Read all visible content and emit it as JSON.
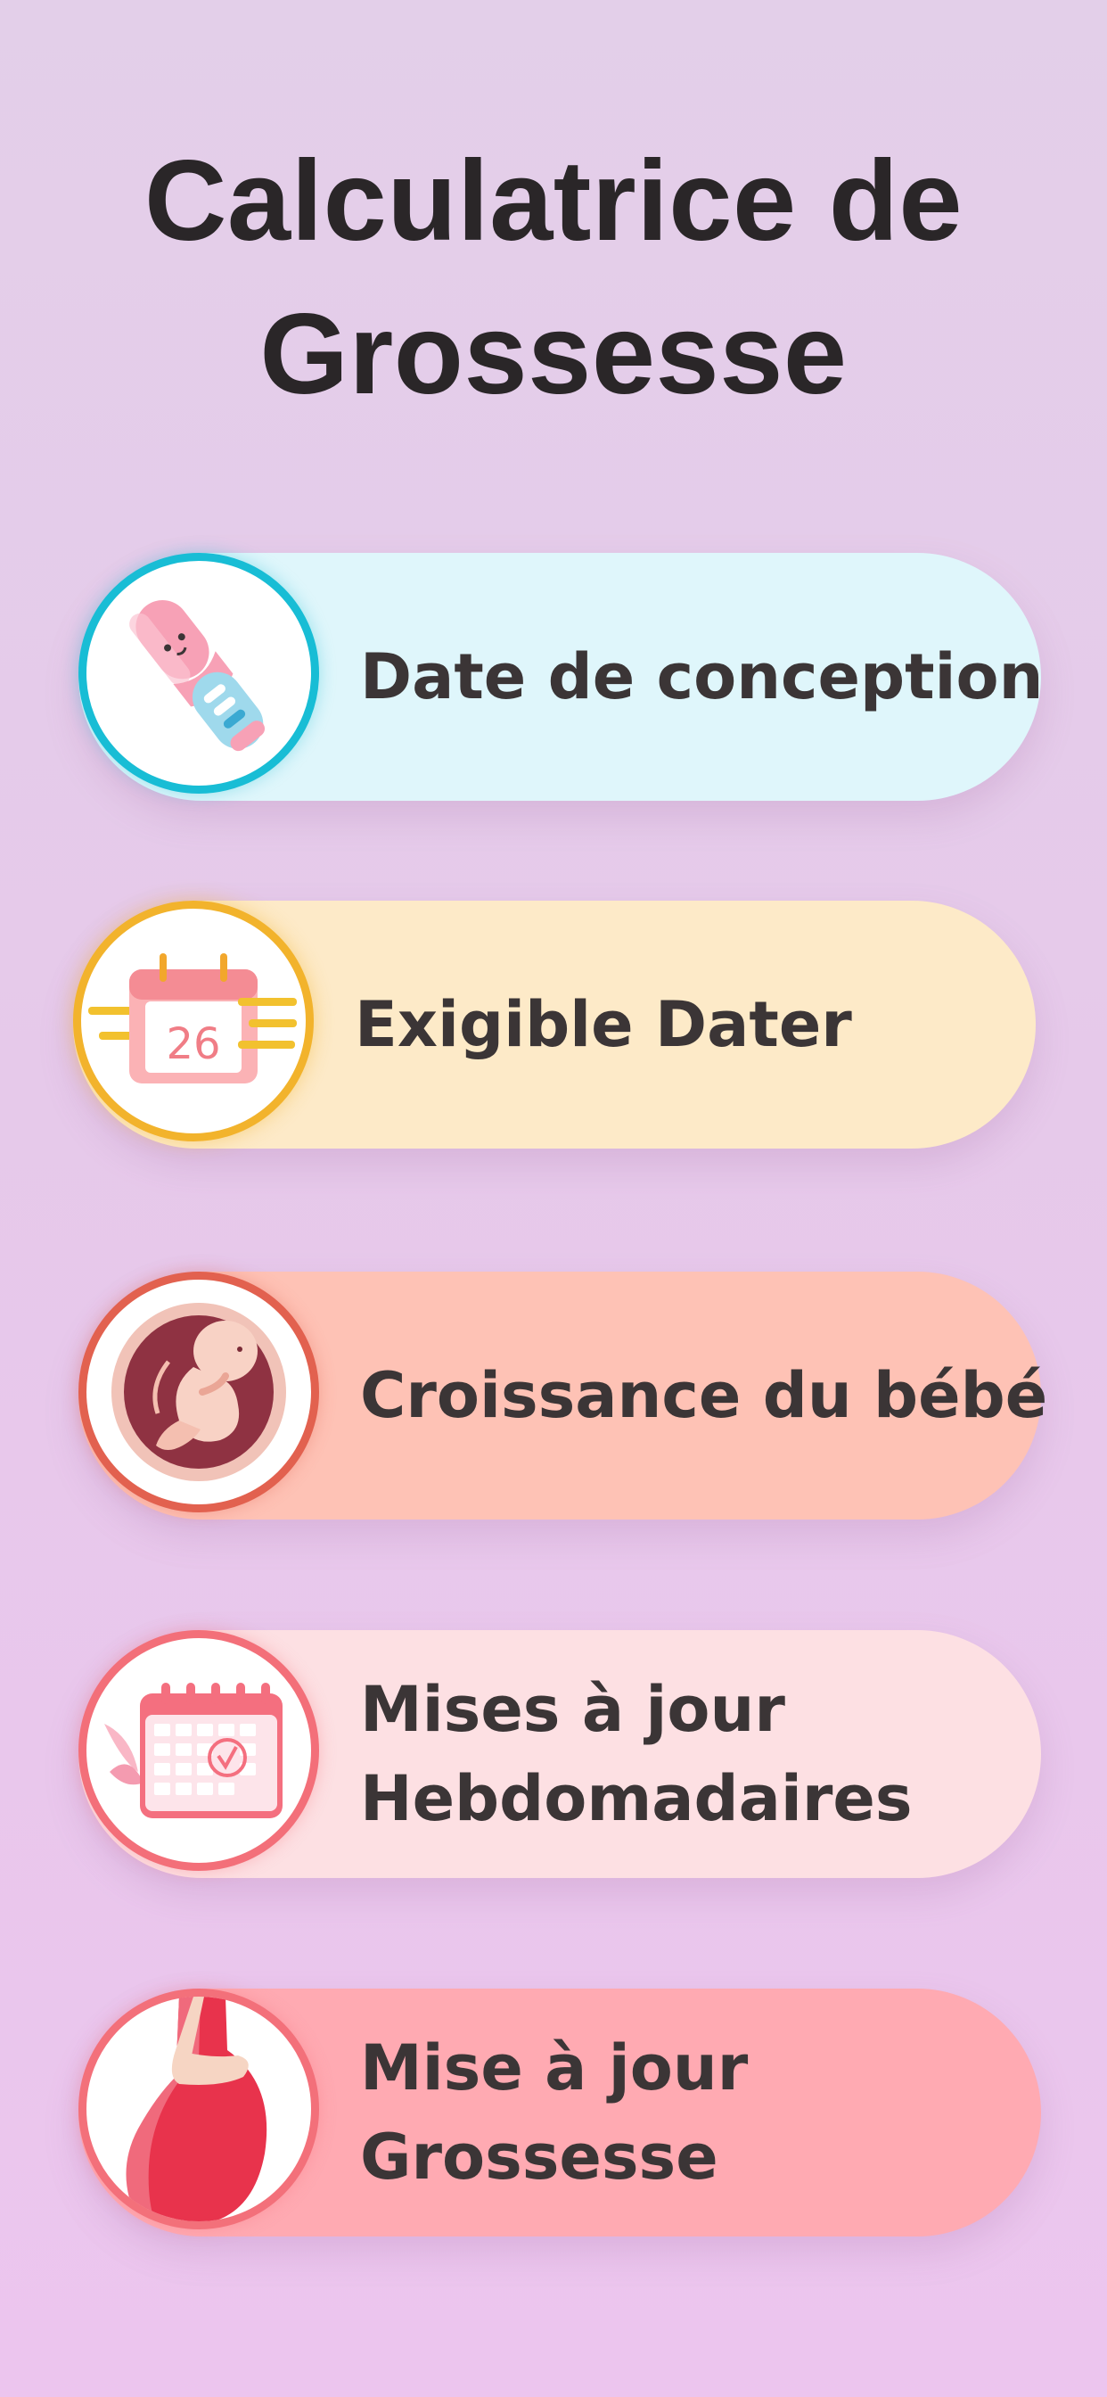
{
  "title": {
    "line1": "Calculatrice de",
    "line2": "Grossesse"
  },
  "menu": [
    {
      "id": "conception",
      "lines": [
        "Date de conception"
      ],
      "icon": "pregnancy-test-icon",
      "accent": "#18bdd5",
      "background": "#dff6fb"
    },
    {
      "id": "due-date",
      "lines": [
        "Exigible Dater"
      ],
      "icon": "calendar-26-icon",
      "calendar_day": "26",
      "accent": "#f2b32c",
      "background": "#fdeac8"
    },
    {
      "id": "baby-growth",
      "lines": [
        "Croissance du bébé"
      ],
      "icon": "fetus-icon",
      "accent": "#e2614f",
      "background": "#fec2b5"
    },
    {
      "id": "weekly-updates",
      "lines": [
        "Mises à jour",
        "Hebdomadaires"
      ],
      "icon": "weekly-calendar-icon",
      "accent": "#f36f79",
      "background": "#fde0e3"
    },
    {
      "id": "pregnancy-update",
      "lines": [
        "Mise à jour",
        "Grossesse"
      ],
      "icon": "pregnant-belly-icon",
      "accent": "#f3707a",
      "background": "#ffaab2"
    }
  ]
}
